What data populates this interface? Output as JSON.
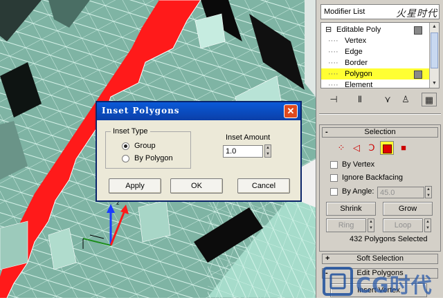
{
  "panel": {
    "modifier_list_label": "Modifier List",
    "watermark": "火星时代",
    "stack_items": [
      {
        "label": "Editable Poly",
        "tree": "⊟"
      },
      {
        "label": "Vertex",
        "tree": "····"
      },
      {
        "label": "Edge",
        "tree": "····"
      },
      {
        "label": "Border",
        "tree": "····"
      },
      {
        "label": "Polygon",
        "tree": "····"
      },
      {
        "label": "Element",
        "tree": "····"
      }
    ],
    "selected_item": "Polygon",
    "highlight_color": "#ffff33"
  },
  "selection": {
    "header": "Selection",
    "header_sign": "-",
    "by_vertex": "By Vertex",
    "ignore_backfacing": "Ignore Backfacing",
    "by_angle": "By Angle:",
    "angle_value": "45.0",
    "shrink": "Shrink",
    "grow": "Grow",
    "ring": "Ring",
    "loop": "Loop",
    "status": "432 Polygons Selected"
  },
  "rollouts": {
    "soft_selection": "Soft Selection",
    "soft_sign": "+",
    "edit_polygons": "Edit Polygons",
    "edit_sign": "-",
    "insert_vertex": "Insert Vertex"
  },
  "dialog": {
    "title": "Inset Polygons",
    "close": "✕",
    "group_title": "Inset Type",
    "option_group": "Group",
    "option_by_polygon": "By Polygon",
    "selected_option": "Group",
    "amount_label": "Inset Amount",
    "amount_value": "1.0",
    "apply": "Apply",
    "ok": "OK",
    "cancel": "Cancel"
  },
  "gizmo": {
    "z_label": "z"
  },
  "logo_text": "CG时代",
  "colors": {
    "selected_faces": "#ff1a1a",
    "mesh": "#9fd6c4",
    "dialog_title": "#0a4fc8",
    "element_active": "#e00000"
  }
}
